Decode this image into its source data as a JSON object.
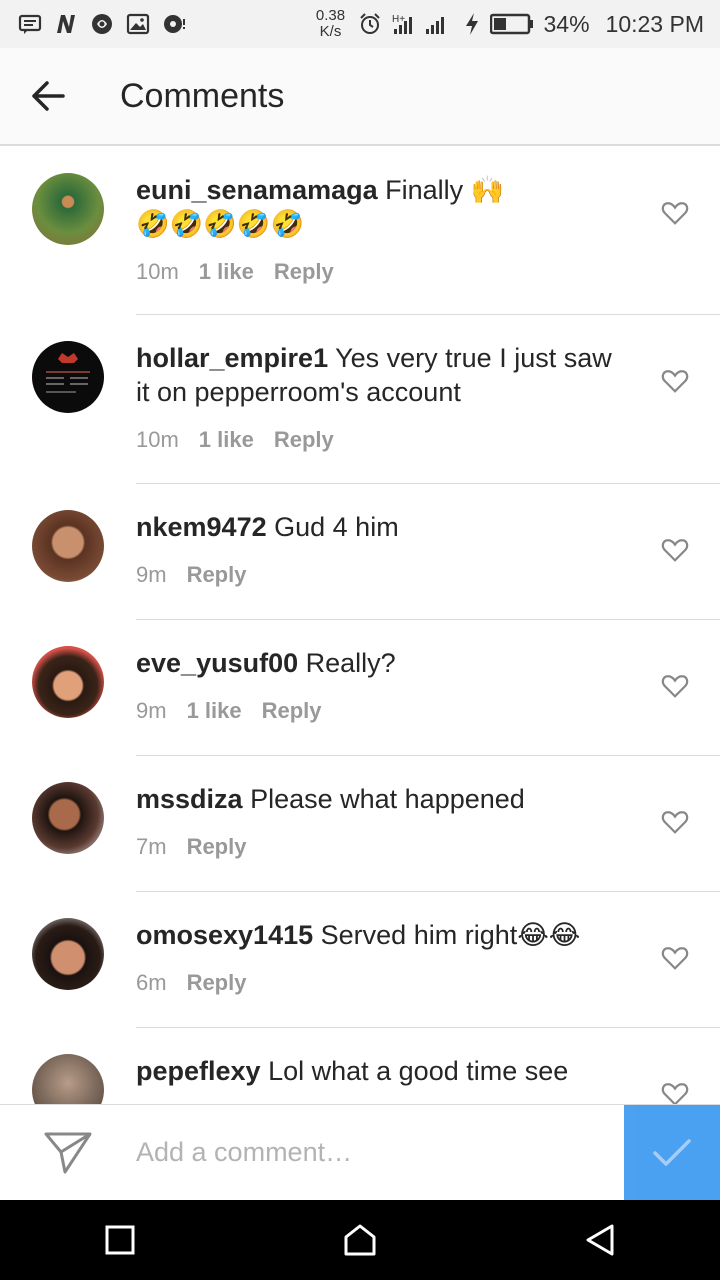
{
  "status_bar": {
    "net_speed_value": "0.38",
    "net_speed_unit": "K/s",
    "battery": "34%",
    "time": "10:23 PM",
    "icons": [
      "message-icon",
      "n-app-icon",
      "vpn-icon",
      "image-icon",
      "media-icon",
      "alarm-icon",
      "signal-icon",
      "charging-icon",
      "battery-icon"
    ]
  },
  "header": {
    "title": "Comments"
  },
  "comments": [
    {
      "username": "euni_senamamaga",
      "text": "Finally 🙌",
      "emoji_line": "🤣🤣🤣🤣🤣",
      "time": "10m",
      "likes": "1 like",
      "reply": "Reply",
      "avatar_color": "#6b8e3e"
    },
    {
      "username": "hollar_empire1",
      "text": "Yes very true I just saw it on pepperroom's account",
      "time": "10m",
      "likes": "1 like",
      "reply": "Reply",
      "avatar_color": "#111111"
    },
    {
      "username": "nkem9472",
      "text": "Gud 4 him",
      "time": "9m",
      "likes": "",
      "reply": "Reply",
      "avatar_color": "#7a4b35"
    },
    {
      "username": "eve_yusuf00",
      "text": "Really?",
      "time": "9m",
      "likes": "1 like",
      "reply": "Reply",
      "avatar_color": "#8b5a3c"
    },
    {
      "username": "mssdiza",
      "text": "Please what happened",
      "time": "7m",
      "likes": "",
      "reply": "Reply",
      "avatar_color": "#5a3a30"
    },
    {
      "username": "omosexy1415",
      "text": "Served him right😂😂",
      "time": "6m",
      "likes": "",
      "reply": "Reply",
      "avatar_color": "#6e4a36"
    },
    {
      "username": "pepeflexy",
      "text": "Lol what a good time see",
      "time": "",
      "likes": "",
      "reply": "",
      "avatar_color": "#7d6a5c"
    }
  ],
  "composer": {
    "placeholder": "Add a comment…"
  },
  "colors": {
    "accent": "#3897f0",
    "meta_text": "#999999",
    "divider": "#dbdbdb"
  }
}
